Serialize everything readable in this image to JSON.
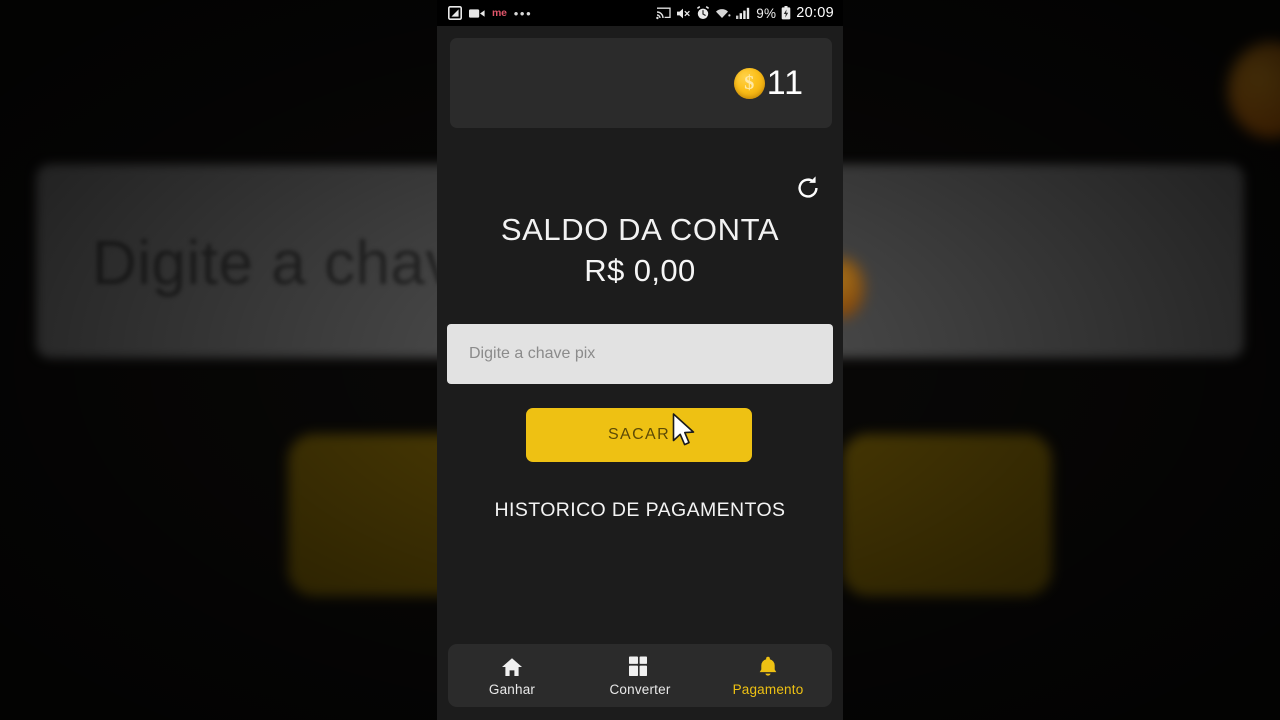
{
  "statusbar": {
    "screenshot_icon": "screenshot-icon",
    "recorder_icon": "screen-recorder-icon",
    "recorder_label": "me",
    "overflow": "•••",
    "cast_icon": "cast-icon",
    "mute_icon": "volume-mute-icon",
    "alarm_icon": "alarm-icon",
    "wifi_icon": "wifi-icon",
    "signal_icon": "cell-signal-icon",
    "battery_percent": "9%",
    "battery_icon": "battery-charging-icon",
    "time": "20:09"
  },
  "coin_card": {
    "coin_icon": "gold-coin-icon",
    "coin_symbol": "$",
    "count": "11"
  },
  "refresh": {
    "icon": "refresh-icon"
  },
  "balance": {
    "title": "SALDO DA CONTA",
    "value": "R$ 0,00"
  },
  "pix": {
    "placeholder": "Digite a chave pix",
    "value": ""
  },
  "actions": {
    "withdraw_label": "SACAR",
    "history_label": "HISTORICO DE PAGAMENTOS"
  },
  "bottom_nav": {
    "items": [
      {
        "label": "Ganhar",
        "icon": "home-icon",
        "active": false
      },
      {
        "label": "Converter",
        "icon": "dashboard-icon",
        "active": false
      },
      {
        "label": "Pagamento",
        "icon": "bell-icon",
        "active": true
      }
    ]
  },
  "background": {
    "blurred_input_text": "Digite a chave"
  },
  "colors": {
    "accent_yellow": "#eec113",
    "app_background": "#1c1c1c",
    "card_background": "#2b2b2b",
    "input_background": "#e2e2e2"
  },
  "cursor": {
    "icon": "mouse-pointer-icon"
  }
}
